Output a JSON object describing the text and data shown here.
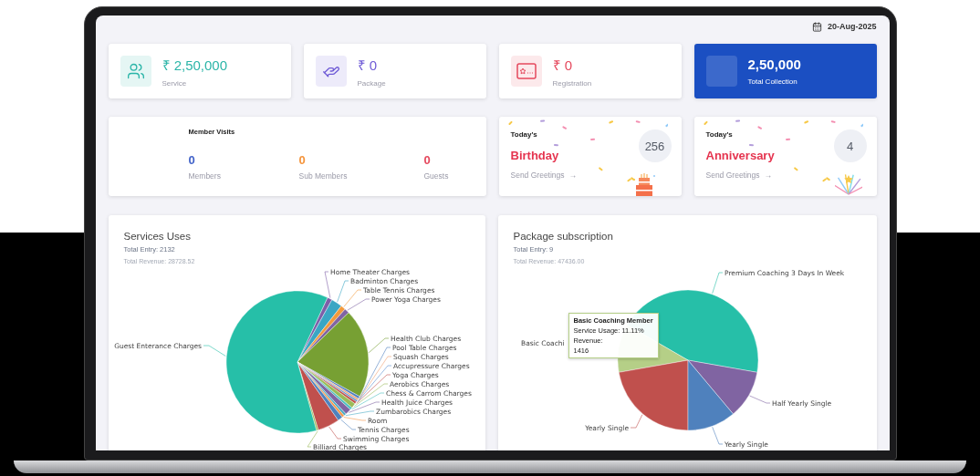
{
  "date": "20-Aug-2025",
  "summary_cards": [
    {
      "kind": "service",
      "value": "₹ 2,50,000",
      "label": "Service",
      "color": "#2bb5a8"
    },
    {
      "kind": "package",
      "value": "₹ 0",
      "label": "Package",
      "color": "#6f5bd6"
    },
    {
      "kind": "registration",
      "value": "₹ 0",
      "label": "Registration",
      "color": "#e5485d"
    },
    {
      "kind": "total",
      "value": "2,50,000",
      "label": "Total Collection",
      "color": "#1b4fc2"
    }
  ],
  "member_visits": {
    "title": "Member Visits",
    "stats": [
      {
        "value": "0",
        "label": "Members",
        "color": "#4263c9"
      },
      {
        "value": "0",
        "label": "Sub Members",
        "color": "#f5943b"
      },
      {
        "value": "0",
        "label": "Guests",
        "color": "#e5485d"
      }
    ]
  },
  "events": [
    {
      "kind": "birthday",
      "prefix": "Today's",
      "title": "Birthday",
      "link": "Send Greetings",
      "arrow": "→",
      "count": "256"
    },
    {
      "kind": "anniversary",
      "prefix": "Today's",
      "title": "Anniversary",
      "link": "Send Greetings",
      "arrow": "→",
      "count": "4"
    }
  ],
  "charts": [
    {
      "kind": "services",
      "title": "Services Uses",
      "total_entry": "Total Entry: 2132",
      "total_revenue": "Total Revenue: 28728.52",
      "labels": [
        "Home Theater Charges",
        "Badminton Charges",
        "Table Tennis Charges",
        "Power Yoga Charges",
        "Health Club Charges",
        "Pool Table Charges",
        "Squash Charges",
        "Accupressure Charges",
        "Yoga Charges",
        "Aerobics Charges",
        "Chess & Carrom Charges",
        "Health Juice Charges",
        "Zumbarobics Charges",
        "Room",
        "Tennis Charges",
        "Swimming Charges",
        "Billiard Charges",
        "Guest Enterance Charges"
      ]
    },
    {
      "kind": "packages",
      "title": "Package subscription",
      "total_entry": "Total Entry: 9",
      "total_revenue": "Total Revenue: 47436.00",
      "labels": [
        "Premium Coaching 3 Days In Week",
        "Basic Coachi",
        "Half Yearly Single",
        "Yearly Single",
        "Yearly Single"
      ],
      "tooltip": {
        "title": "Basic Coaching Member",
        "lines": [
          "Service Usage: 11.11%",
          "Revenue:",
          "1416"
        ]
      }
    }
  ]
}
